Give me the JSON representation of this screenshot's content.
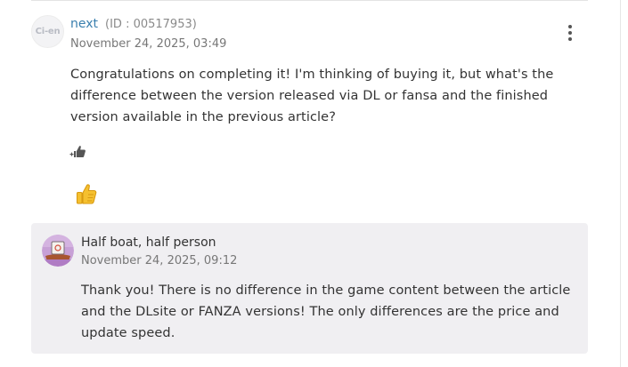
{
  "comment": {
    "avatar_text": "Ci-en",
    "author": "next",
    "user_id": "(ID : 00517953)",
    "date": "November 24, 2025, 03:49",
    "body": "Congratulations on completing it! I'm thinking of buying it, but what's the difference between the version released via DL or fansa and the finished version available in the previous article?",
    "like_icon": "thumbs-up-plus-icon",
    "reaction_icon": "thumbs-up-emoji"
  },
  "reply": {
    "author": "Half boat, half person",
    "date": "November 24, 2025, 09:12",
    "body": "Thank you! There is no difference in the game content between the article and the DLsite or FANZA versions! The only differences are the price and update speed."
  },
  "colors": {
    "author_link": "#3a7fae",
    "reply_background": "#f0eff2",
    "reaction_yellow": "#f5c02f"
  }
}
